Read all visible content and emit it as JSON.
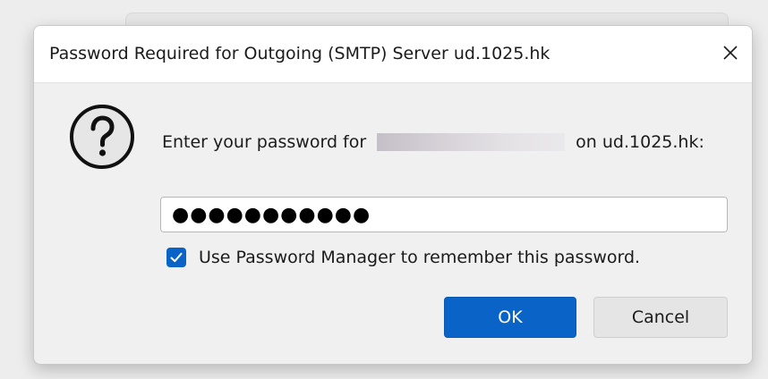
{
  "dialog": {
    "title": "Password Required for Outgoing (SMTP) Server ud.1025.hk",
    "prompt_prefix": "Enter your password for",
    "prompt_suffix": "on ud.1025.hk:",
    "password_value": "●●●●●●●●●●●",
    "remember_checked": true,
    "remember_label": "Use Password Manager to remember this password.",
    "ok_label": "OK",
    "cancel_label": "Cancel"
  },
  "icons": {
    "close": "close-icon",
    "question": "question-icon",
    "check": "check-icon"
  },
  "colors": {
    "accent": "#0a64c8",
    "dialog_bg": "#f0f0f0",
    "titlebar_bg": "#ffffff",
    "cancel_bg": "#e5e5e5"
  }
}
